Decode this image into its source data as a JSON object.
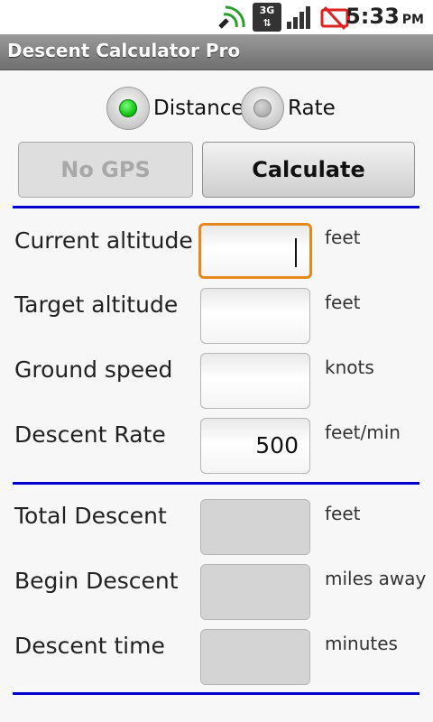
{
  "status": {
    "time": "5:33",
    "ampm": "PM",
    "network": "3G"
  },
  "titlebar": {
    "title": "Descent Calculator Pro"
  },
  "mode": {
    "options": [
      {
        "label": "Distance",
        "selected": true
      },
      {
        "label": "Rate",
        "selected": false
      }
    ]
  },
  "buttons": {
    "gps": "No GPS",
    "calculate": "Calculate"
  },
  "inputs": [
    {
      "label": "Current altitude",
      "value": "",
      "unit": "feet"
    },
    {
      "label": "Target altitude",
      "value": "",
      "unit": "feet"
    },
    {
      "label": "Ground speed",
      "value": "",
      "unit": "knots"
    },
    {
      "label": "Descent Rate",
      "value": "500",
      "unit": "feet/min"
    }
  ],
  "outputs": [
    {
      "label": "Total Descent",
      "value": "",
      "unit": "feet"
    },
    {
      "label": "Begin Descent",
      "value": "",
      "unit": "miles away"
    },
    {
      "label": "Descent time",
      "value": "",
      "unit": "minutes"
    }
  ],
  "colors": {
    "divider": "#0000cc",
    "focus": "#e58a1a",
    "radio_on": "#16c416"
  }
}
